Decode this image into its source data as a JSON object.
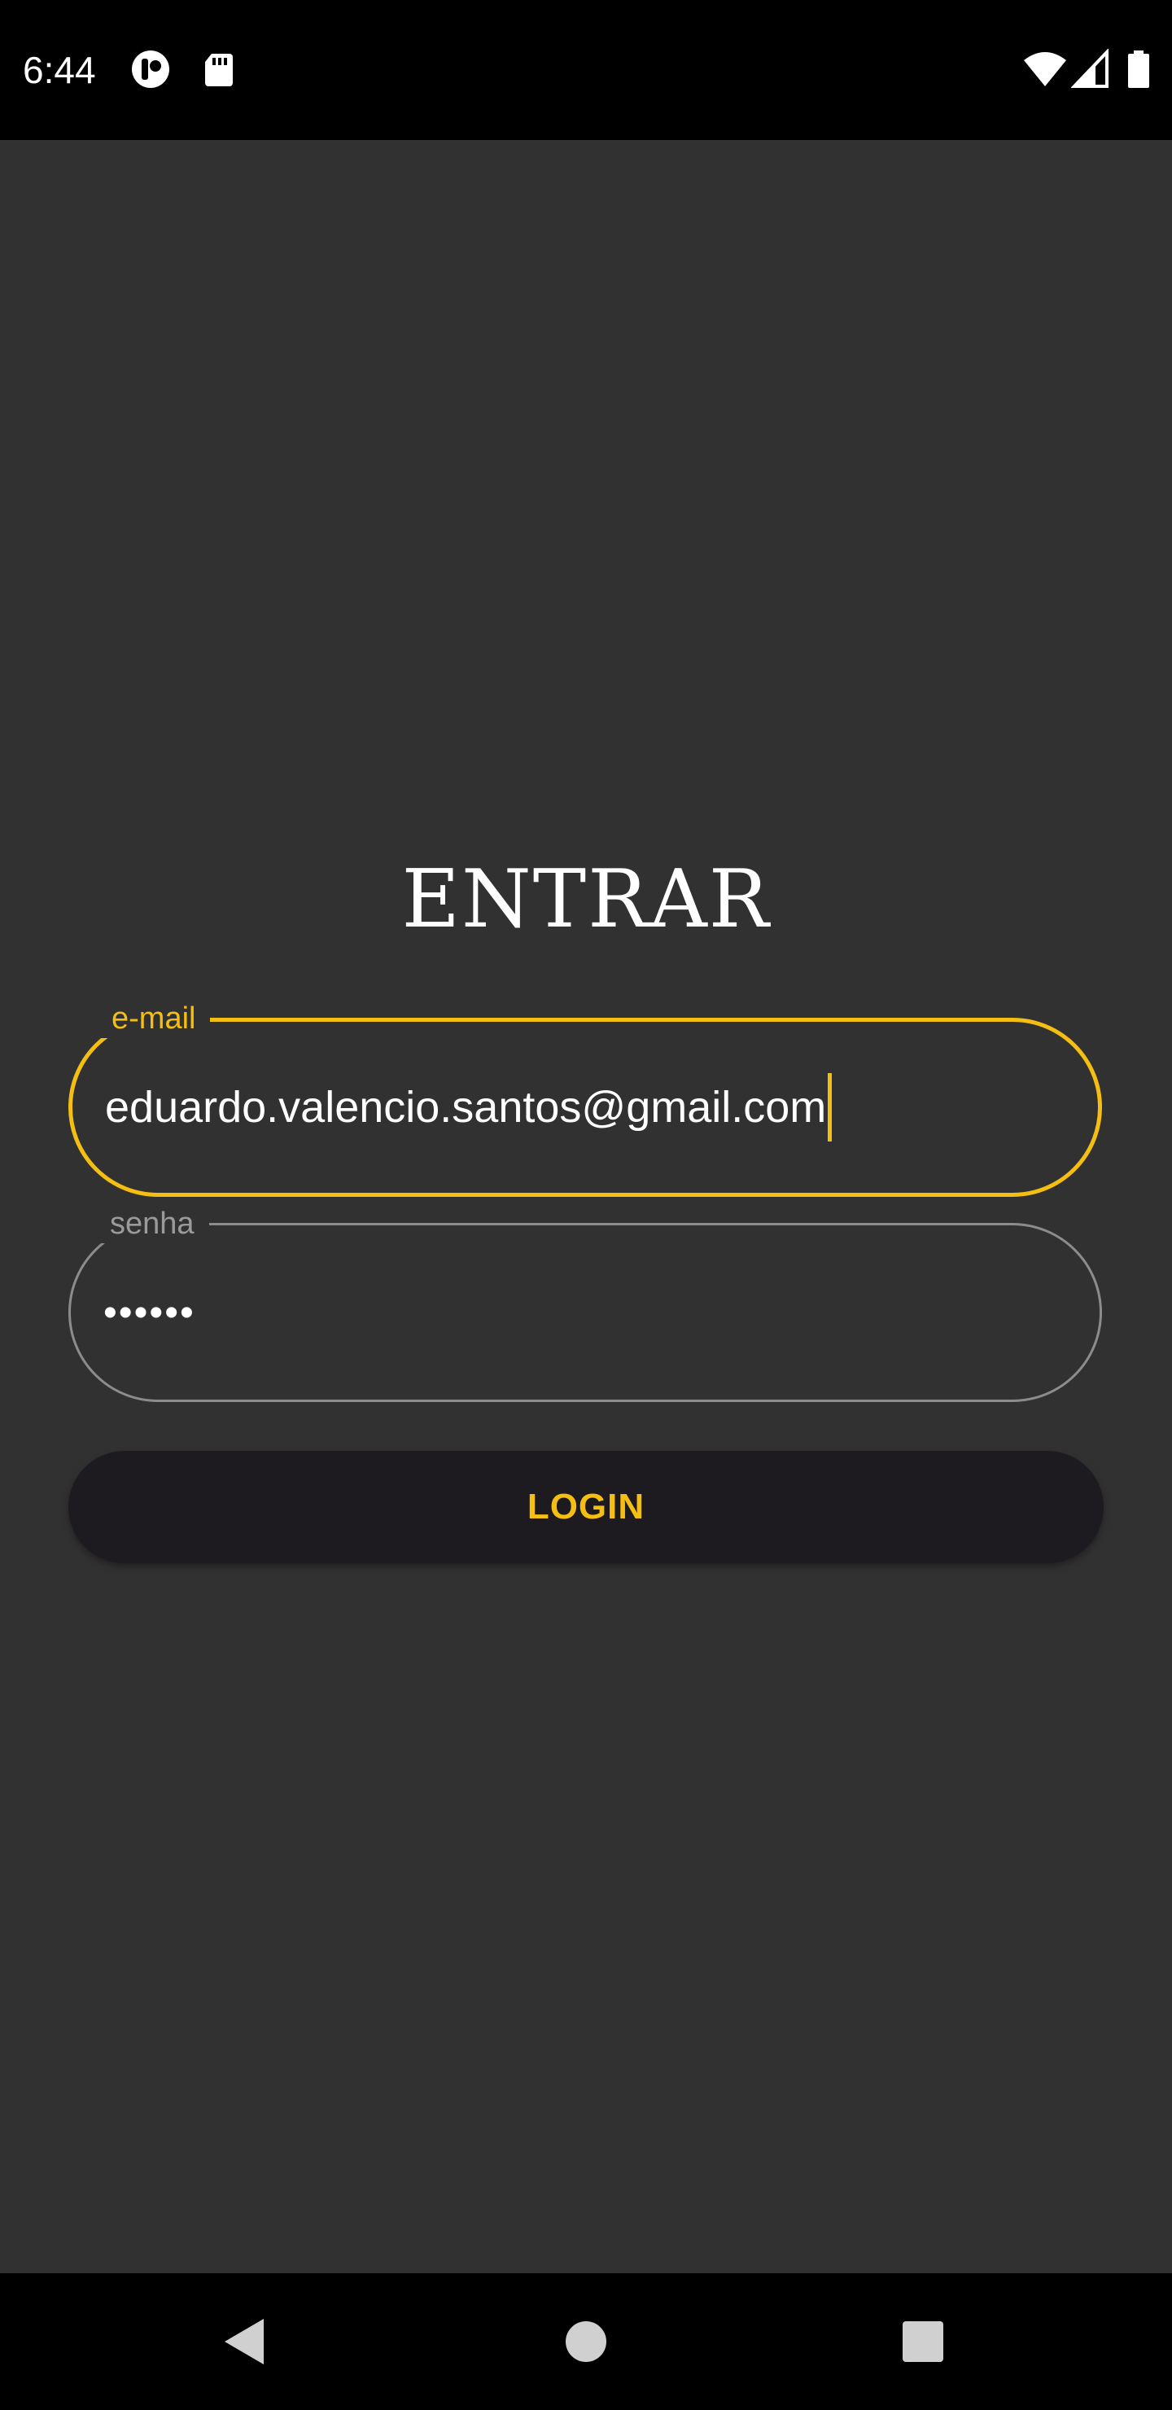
{
  "status_bar": {
    "time": "6:44",
    "icons": [
      "app-notification-icon",
      "sd-card-icon",
      "wifi-icon",
      "cell-signal-icon",
      "battery-icon"
    ]
  },
  "login": {
    "title": "ENTRAR",
    "email": {
      "label": "e-mail",
      "value": "eduardo.valencio.santos@gmail.com"
    },
    "password": {
      "label": "senha",
      "value": "••••••"
    },
    "button_label": "LOGIN"
  },
  "nav_bar": {
    "buttons": [
      "back-icon",
      "home-icon",
      "recents-icon"
    ]
  },
  "colors": {
    "background": "#313131",
    "accent": "#F5BE12",
    "button_bg": "#1d1b20",
    "system_bars": "#000000"
  }
}
